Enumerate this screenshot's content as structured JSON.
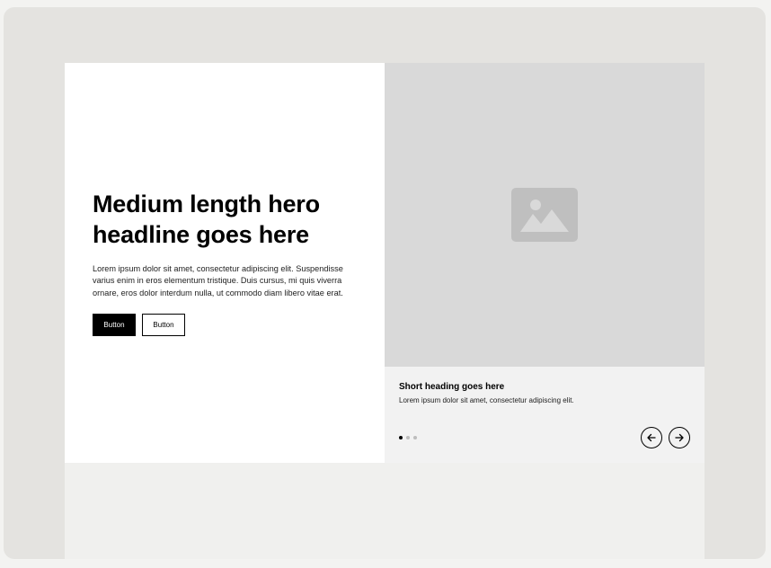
{
  "hero": {
    "headline": "Medium length hero headline goes here",
    "body": "Lorem ipsum dolor sit amet, consectetur adipiscing elit. Suspendisse varius enim in eros elementum tristique. Duis cursus, mi quis viverra ornare, eros dolor interdum nulla, ut commodo diam libero vitae erat.",
    "primary_button": "Button",
    "secondary_button": "Button"
  },
  "slider": {
    "image_icon": "image-placeholder-icon",
    "heading": "Short heading goes here",
    "text": "Lorem ipsum dolor sit amet, consectetur adipiscing elit.",
    "slide_count": 3,
    "active_slide": 1,
    "prev_icon": "arrow-left-icon",
    "next_icon": "arrow-right-icon"
  },
  "colors": {
    "image_placeholder": "#d9d9d9",
    "icon_fill": "#bfbfbf",
    "primary": "#000000"
  }
}
